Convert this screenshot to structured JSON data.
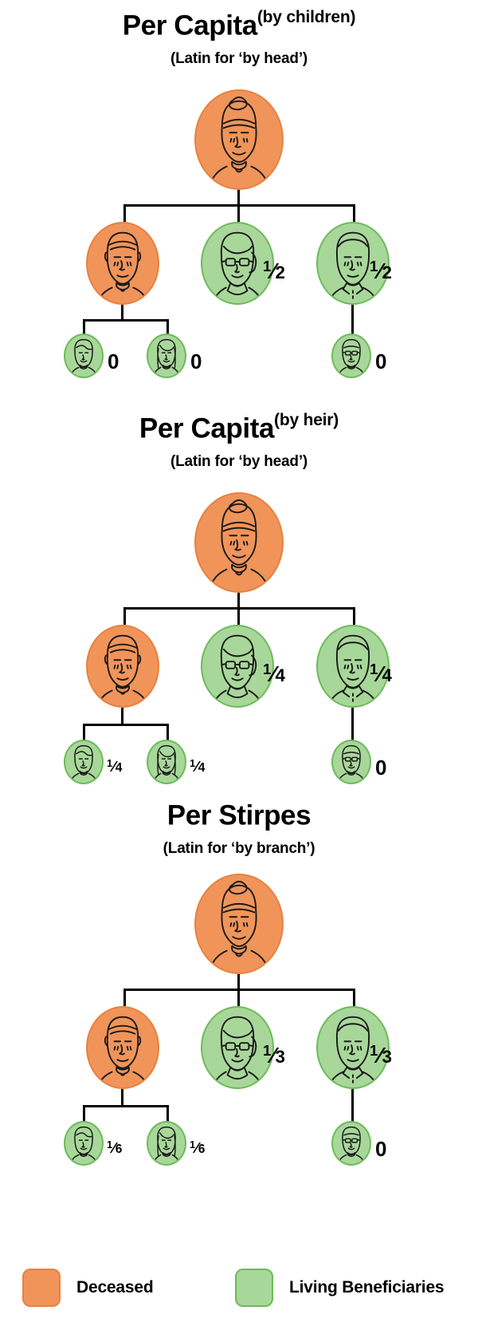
{
  "sections": [
    {
      "id": "per-capita-by-children",
      "title": "Per Capita",
      "title_sup": "(by children)",
      "subtitle": "(Latin for ‘by head’)",
      "root": {
        "role": "grandmother",
        "status": "Deceased"
      },
      "children": [
        {
          "role": "son",
          "status": "Deceased",
          "share": ""
        },
        {
          "role": "daughter",
          "status": "Living",
          "share": "1/2"
        },
        {
          "role": "son-2",
          "status": "Living",
          "share": "1/2"
        }
      ],
      "grandchildren": [
        {
          "role": "grandson",
          "status": "Living",
          "share": "0",
          "parent": 0
        },
        {
          "role": "granddaughter",
          "status": "Living",
          "share": "0",
          "parent": 0
        },
        {
          "role": "grandson-2",
          "status": "Living",
          "share": "0",
          "parent": 2
        }
      ]
    },
    {
      "id": "per-capita-by-heir",
      "title": "Per Capita",
      "title_sup": "(by heir)",
      "subtitle": "(Latin for ‘by head’)",
      "root": {
        "role": "grandmother",
        "status": "Deceased"
      },
      "children": [
        {
          "role": "son",
          "status": "Deceased",
          "share": ""
        },
        {
          "role": "daughter",
          "status": "Living",
          "share": "1/4"
        },
        {
          "role": "son-2",
          "status": "Living",
          "share": "1/4"
        }
      ],
      "grandchildren": [
        {
          "role": "grandson",
          "status": "Living",
          "share": "1/4",
          "parent": 0
        },
        {
          "role": "granddaughter",
          "status": "Living",
          "share": "1/4",
          "parent": 0
        },
        {
          "role": "grandson-2",
          "status": "Living",
          "share": "0",
          "parent": 2
        }
      ]
    },
    {
      "id": "per-stirpes",
      "title": "Per Stirpes",
      "title_sup": "",
      "subtitle": "(Latin for ‘by branch’)",
      "root": {
        "role": "grandmother",
        "status": "Deceased"
      },
      "children": [
        {
          "role": "son",
          "status": "Deceased",
          "share": ""
        },
        {
          "role": "daughter",
          "status": "Living",
          "share": "1/3"
        },
        {
          "role": "son-2",
          "status": "Living",
          "share": "1/3"
        }
      ],
      "grandchildren": [
        {
          "role": "grandson",
          "status": "Living",
          "share": "1/6",
          "parent": 0
        },
        {
          "role": "granddaughter",
          "status": "Living",
          "share": "1/6",
          "parent": 0
        },
        {
          "role": "grandson-2",
          "status": "Living",
          "share": "0",
          "parent": 2
        }
      ]
    }
  ],
  "legend": {
    "deceased_label": "Deceased",
    "living_label": "Living Beneficiaries"
  },
  "colors": {
    "deceased_fill": "#f0945a",
    "deceased_stroke": "#e8813f",
    "living_fill": "#a8d79a",
    "living_stroke": "#6cbb5a",
    "line": "#000000",
    "background": "#ffffff"
  },
  "s1": {
    "title": "Per Capita",
    "sup": "(by children)",
    "sub": "(Latin for ‘by head’)",
    "c2": "1/2",
    "c3": "1/2",
    "g1": "0",
    "g2": "0",
    "g3": "0"
  },
  "s2": {
    "title": "Per Capita",
    "sup": "(by heir)",
    "sub": "(Latin for ‘by head’)",
    "c2": "1/4",
    "c3": "1/4",
    "g1": "1/4",
    "g2": "1/4",
    "g3": "0"
  },
  "s3": {
    "title": "Per Stirpes",
    "sup": "",
    "sub": "(Latin for ‘by branch’)",
    "c2": "1/3",
    "c3": "1/3",
    "g1": "1/6",
    "g2": "1/6",
    "g3": "0"
  }
}
